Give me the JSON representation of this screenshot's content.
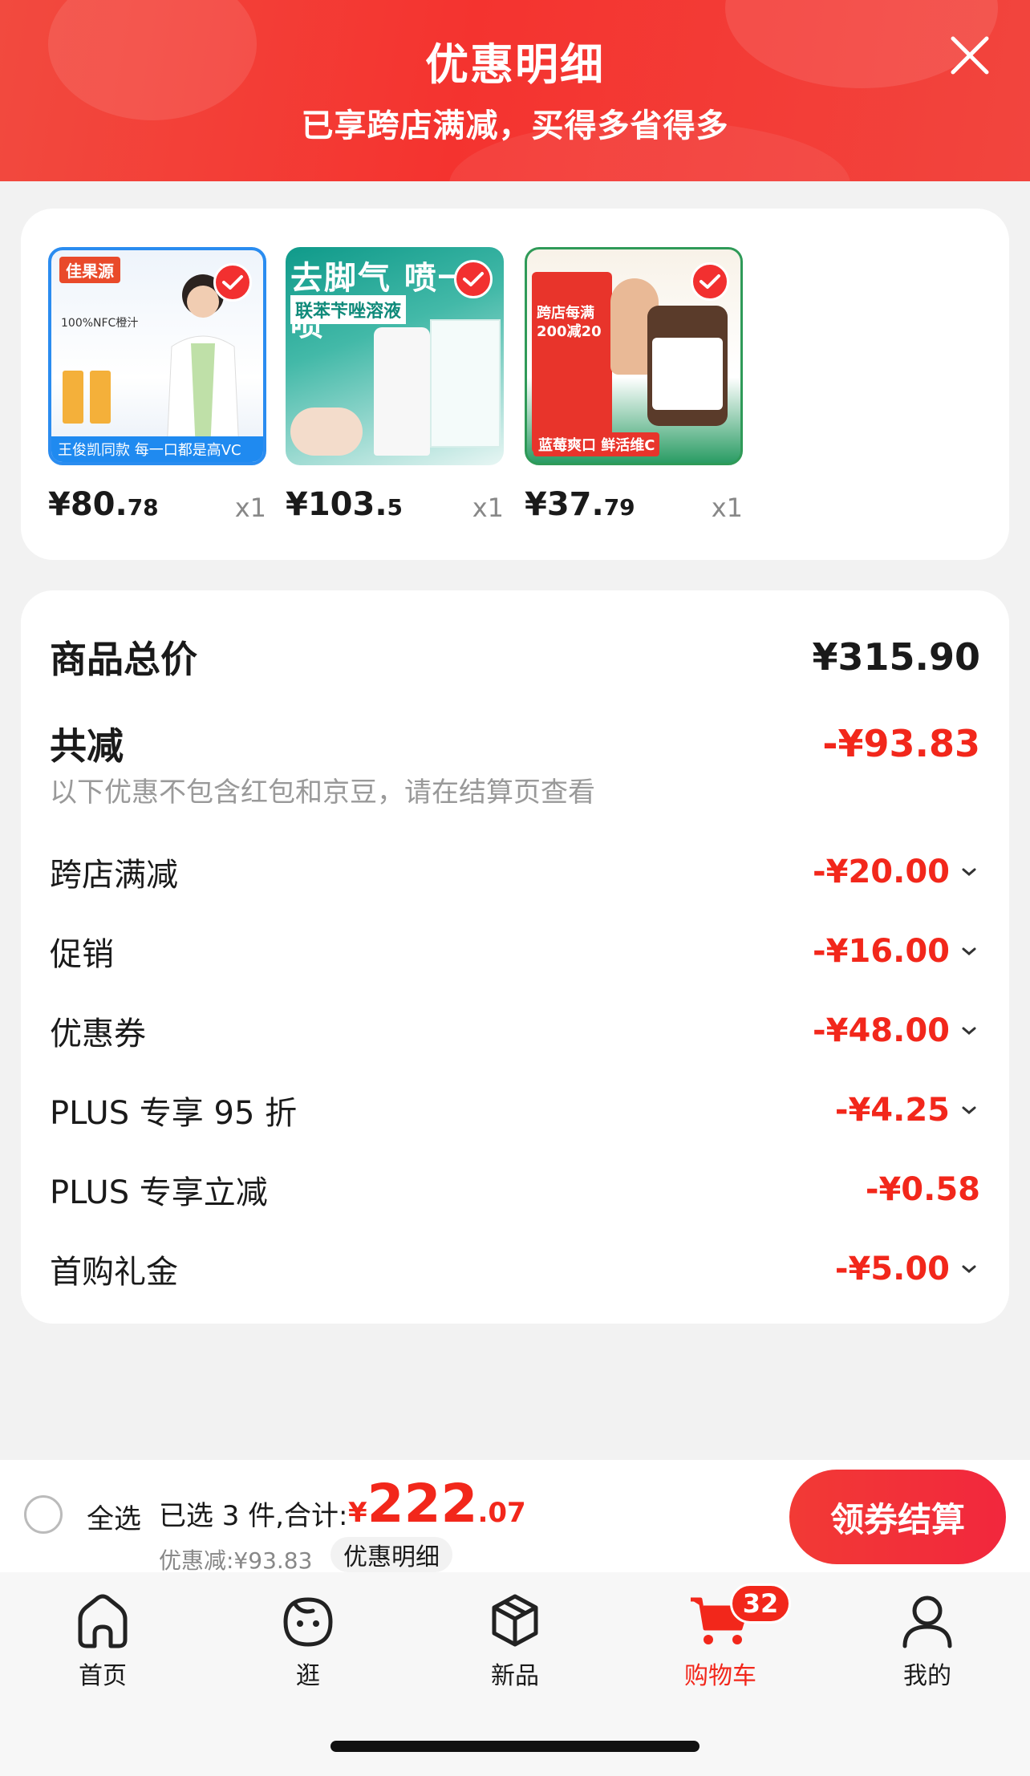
{
  "header": {
    "title": "优惠明细",
    "subtitle": "已享跨店满减，买得多省得多"
  },
  "products": [
    {
      "price_int": "¥80.",
      "price_dec": "78",
      "qty": "x1",
      "thumb_brand": "佳果源",
      "thumb_text": "100%NFC橙汁",
      "thumb_footer": "王俊凯同款  每一口都是高VC"
    },
    {
      "price_int": "¥103.",
      "price_dec": "5",
      "qty": "x1",
      "thumb_title": "去脚气 喷一喷",
      "thumb_band": "联苯苄唑溶液"
    },
    {
      "price_int": "¥37.",
      "price_dec": "79",
      "qty": "x1",
      "thumb_text": "跨店每满200减20",
      "thumb_footer": "蓝莓爽口 鲜活维C"
    }
  ],
  "summary": {
    "total_label": "商品总价",
    "total_value": "¥315.90",
    "less_label": "共减",
    "less_value": "-¥93.83",
    "note": "以下优惠不包含红包和京豆，请在结算页查看",
    "items": [
      {
        "label": "跨店满减",
        "value": "-¥20.00",
        "expandable": true
      },
      {
        "label": "促销",
        "value": "-¥16.00",
        "expandable": true
      },
      {
        "label": "优惠券",
        "value": "-¥48.00",
        "expandable": true
      },
      {
        "label": "PLUS 专享 95 折",
        "value": "-¥4.25",
        "expandable": true
      },
      {
        "label": "PLUS 专享立减",
        "value": "-¥0.58",
        "expandable": false
      },
      {
        "label": "首购礼金",
        "value": "-¥5.00",
        "expandable": true
      }
    ]
  },
  "bottom_bar": {
    "select_all": "全选",
    "selected_info": "已选 3 件,合计:",
    "total_currency": "¥",
    "total_int": "222",
    "total_dec": ".07",
    "discount_line": "优惠减:¥93.83",
    "detail_tag": "优惠明细",
    "checkout": "领券结算"
  },
  "tabs": [
    {
      "label": "首页",
      "icon": "home-icon"
    },
    {
      "label": "逛",
      "icon": "face-icon"
    },
    {
      "label": "新品",
      "icon": "cube-icon"
    },
    {
      "label": "购物车",
      "icon": "cart-icon",
      "active": true,
      "badge": "32"
    },
    {
      "label": "我的",
      "icon": "user-icon"
    }
  ],
  "colors": {
    "accent": "#f2271b",
    "header": "#f4332f"
  }
}
